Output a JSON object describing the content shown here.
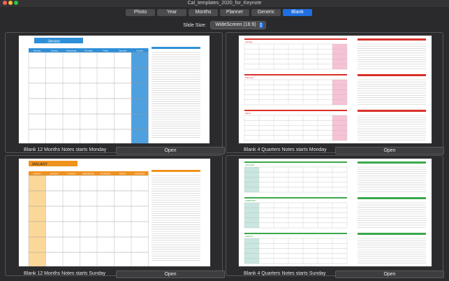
{
  "window": {
    "title": "Cal_templates_2020_for_Keynote"
  },
  "tabs": [
    {
      "label": "Photo",
      "active": false
    },
    {
      "label": "Year",
      "active": false
    },
    {
      "label": "Months",
      "active": false
    },
    {
      "label": "Planner",
      "active": false
    },
    {
      "label": "Generic",
      "active": false
    },
    {
      "label": "Blank",
      "active": true
    }
  ],
  "slide_size": {
    "label": "Slide Size:",
    "value": "WideScreen (16:9)"
  },
  "templates": [
    {
      "caption": "Blank 12 Months Notes starts Monday",
      "open_label": "Open",
      "accent": "#2f8fd8",
      "month_title": "January",
      "weekdays": [
        "Monday",
        "Tuesday",
        "Wednesday",
        "Thursday",
        "Friday",
        "Saturday",
        "Sunday"
      ]
    },
    {
      "caption": "Blank 4 Quarters Notes starts Monday",
      "open_label": "Open",
      "accent": "#d9302a",
      "months": [
        "January",
        "February",
        "March"
      ]
    },
    {
      "caption": "Blank 12 Months Notes starts Sunday",
      "open_label": "Open",
      "accent": "#f0921e",
      "month_title": "JANUARY",
      "weekdays": [
        "SUNDAY",
        "MONDAY",
        "TUESDAY",
        "WEDNESDAY",
        "THURSDAY",
        "FRIDAY",
        "SATURDAY"
      ]
    },
    {
      "caption": "Blank 4 Quarters Notes starts Sunday",
      "open_label": "Open",
      "accent": "#3aa84a",
      "months": [
        "JANUARY",
        "FEBRUARY",
        "MARCH"
      ]
    }
  ]
}
